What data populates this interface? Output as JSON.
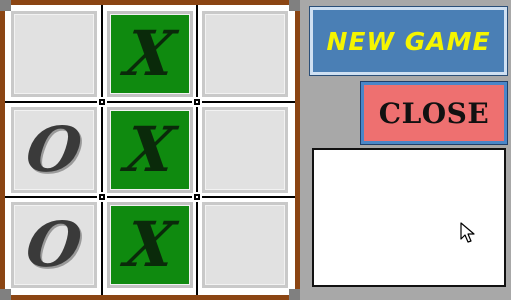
{
  "board": {
    "cells": [
      {
        "mark": "",
        "highlight": false
      },
      {
        "mark": "X",
        "highlight": true
      },
      {
        "mark": "",
        "highlight": false
      },
      {
        "mark": "O",
        "highlight": false
      },
      {
        "mark": "X",
        "highlight": true
      },
      {
        "mark": "",
        "highlight": false
      },
      {
        "mark": "O",
        "highlight": false
      },
      {
        "mark": "X",
        "highlight": true
      },
      {
        "mark": "",
        "highlight": false
      }
    ]
  },
  "buttons": {
    "new_game": "NEW GAME",
    "close": "CLOSE"
  },
  "message_box": {
    "text": ""
  },
  "colors": {
    "win_cell": "#0f8a0f",
    "empty_cell": "#e1e1e1",
    "new_game_bg": "#4a7fb5",
    "new_game_text": "#f5f500",
    "close_bg": "#ee7070",
    "panel_bg": "#a8a8a8",
    "frame_wood": "#8b4513"
  },
  "icons": {
    "cursor": "mouse-pointer-icon"
  }
}
